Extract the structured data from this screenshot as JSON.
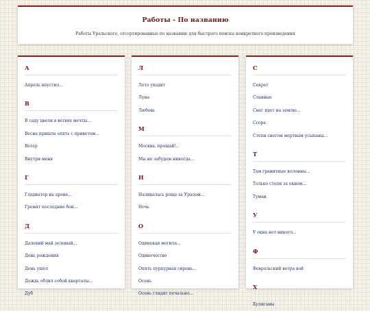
{
  "header": {
    "title": "Работы - По названию",
    "subtitle": "Работы Уральского, отсортированные по названию для быстрого поиска конкретного произведения"
  },
  "columns": [
    {
      "sections": [
        {
          "letter": "А",
          "items": [
            "Апрель впустил..."
          ]
        },
        {
          "letter": "В",
          "items": [
            "В саду цвели в ветвях мечты...",
            "Весна пришла опять с приветом...",
            "Ветер",
            "Внутри меня"
          ]
        },
        {
          "letter": "Г",
          "items": [
            "Гладиатор на арене...",
            "Гремят последние бои..."
          ]
        },
        {
          "letter": "Д",
          "items": [
            "Далекий май зеленый...",
            "День рождения",
            "День ушел",
            "Дождь облил собой кварталы...",
            "Дуб"
          ]
        }
      ]
    },
    {
      "sections": [
        {
          "letter": "Л",
          "items": [
            "Лето уходит",
            "Луна",
            "Любовь"
          ]
        },
        {
          "letter": "М",
          "items": [
            "Москва, прощай!..",
            "Мы не забудем никогда..."
          ]
        },
        {
          "letter": "Н",
          "items": [
            "Наливалась роща за Уралом...",
            "Ночь"
          ]
        },
        {
          "letter": "О",
          "items": [
            "Одинокая могила...",
            "Одиночество",
            "Опять пурпурная сирень...",
            "Осень",
            "Осень глядит печально..."
          ]
        }
      ]
    },
    {
      "sections": [
        {
          "letter": "С",
          "items": [
            "Секрет",
            "Славные",
            "Снег идет на землю...",
            "Ссора",
            "Степи снегом мертвым усыпаны..."
          ]
        },
        {
          "letter": "Т",
          "items": [
            "Там гранитные колонны...",
            "Только степи за окном...",
            "Туман"
          ]
        },
        {
          "letter": "У",
          "items": [
            "У окна нет никого..."
          ]
        },
        {
          "letter": "Ф",
          "items": [
            "Февральский ветра вой"
          ]
        },
        {
          "letter": "Х",
          "items": [
            "Хулиганы"
          ]
        }
      ]
    }
  ]
}
